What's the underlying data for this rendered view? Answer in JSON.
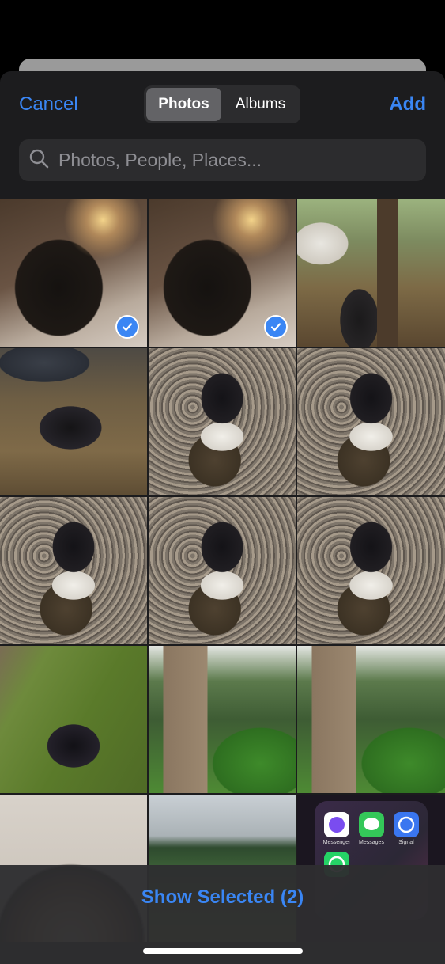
{
  "header": {
    "cancel_label": "Cancel",
    "add_label": "Add",
    "tabs": [
      {
        "label": "Photos",
        "active": true
      },
      {
        "label": "Albums",
        "active": false
      }
    ]
  },
  "search": {
    "placeholder": "Photos, People, Places...",
    "value": ""
  },
  "photos": [
    {
      "subject": "dog on bed",
      "selected": true
    },
    {
      "subject": "dog on bed",
      "selected": true
    },
    {
      "subject": "dog in yard by truck and tree",
      "selected": false
    },
    {
      "subject": "dog on road by car",
      "selected": false
    },
    {
      "subject": "dog sitting on stump",
      "selected": false
    },
    {
      "subject": "dog sitting on stump",
      "selected": false
    },
    {
      "subject": "dog sitting on stump",
      "selected": false
    },
    {
      "subject": "dog sitting on stump",
      "selected": false
    },
    {
      "subject": "dog close-up",
      "selected": false
    },
    {
      "subject": "dog on grass",
      "selected": false
    },
    {
      "subject": "garden stairs",
      "selected": false
    },
    {
      "subject": "garden",
      "selected": false
    },
    {
      "subject": "latte art coffee",
      "selected": false
    },
    {
      "subject": "park field with cones",
      "selected": false
    },
    {
      "subject": "phone screenshot",
      "selected": false
    }
  ],
  "screenshot_apps": [
    {
      "label": "Messenger",
      "color": "#7a4cf0"
    },
    {
      "label": "Messages",
      "color": "#34c759"
    },
    {
      "label": "Signal",
      "color": "#3a76f0"
    },
    {
      "label": "",
      "color": "#25d366"
    }
  ],
  "footer": {
    "show_selected_label": "Show Selected (2)"
  },
  "colors": {
    "accent": "#3a86f4",
    "sheet_background": "#1c1c1e"
  }
}
